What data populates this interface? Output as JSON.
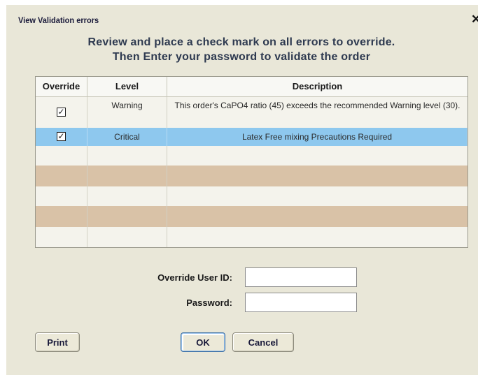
{
  "window": {
    "title": "View Validation errors",
    "close_glyph": "✕"
  },
  "instructions": {
    "line1": "Review and place a check mark on all errors to override.",
    "line2": "Then Enter your password to validate the order"
  },
  "grid": {
    "columns": [
      "Override",
      "Level",
      "Description"
    ],
    "rows": [
      {
        "override": true,
        "level": "Warning",
        "description": "This order's CaPO4 ratio (45) exceeds the recommended Warning level (30).",
        "selected": false
      },
      {
        "override": true,
        "level": "Critical",
        "description": "Latex Free mixing Precautions Required",
        "selected": true
      }
    ]
  },
  "form": {
    "user_id_label": "Override User ID:",
    "user_id_value": "",
    "password_label": "Password:",
    "password_value": ""
  },
  "buttons": {
    "print": "Print",
    "ok": "OK",
    "cancel": "Cancel"
  },
  "checkmark_glyph": "✓",
  "colors": {
    "dialog_bg": "#e9e7d8",
    "selected_row": "#8ec8ee",
    "alt_row": "#d9c2a7"
  }
}
